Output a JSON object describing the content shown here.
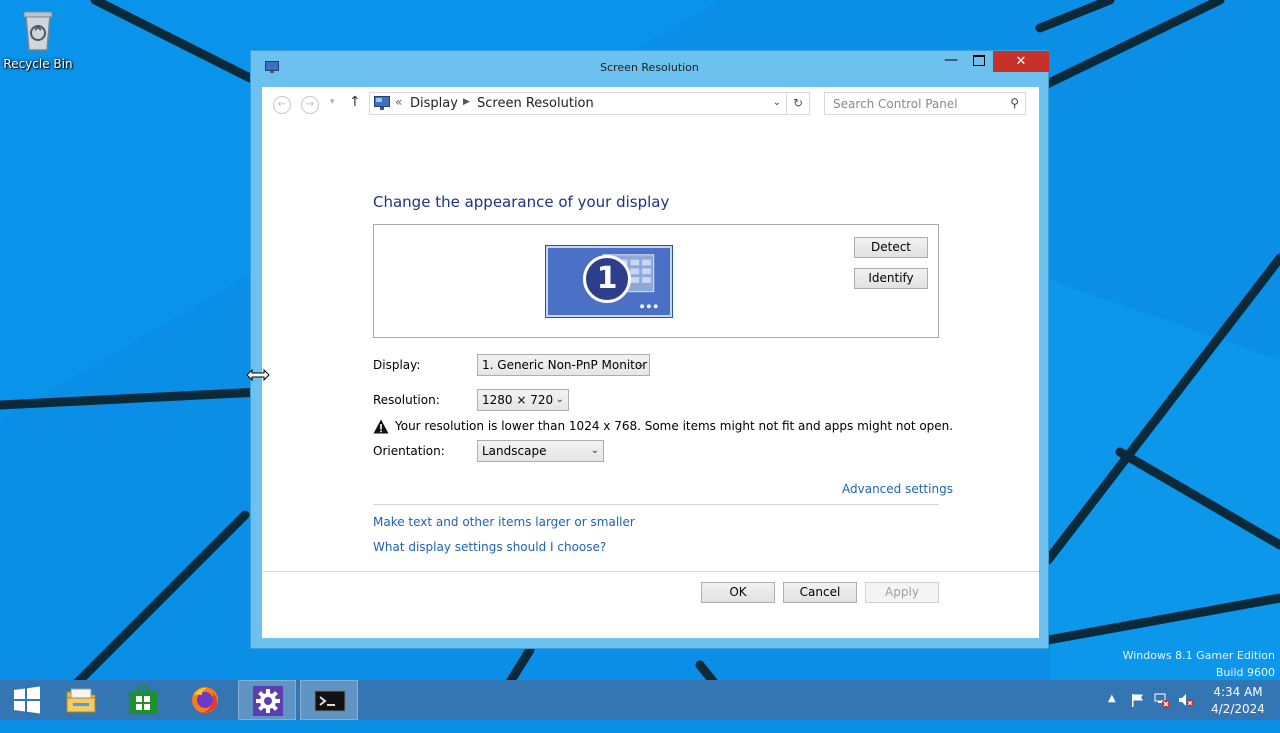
{
  "desktop": {
    "recycle_bin_label": "Recycle Bin",
    "watermark_line1": "Windows 8.1 Gamer Edition",
    "watermark_line2": "Build 9600"
  },
  "window": {
    "title": "Screen Resolution",
    "close_glyph": "✕",
    "minimize_glyph": "—"
  },
  "navbar": {
    "breadcrumb_separator": "«",
    "crumb_display": "Display",
    "crumb_current": "Screen Resolution",
    "search_placeholder": "Search Control Panel"
  },
  "main": {
    "heading": "Change the appearance of your display",
    "monitor_number": "1",
    "detect_label": "Detect",
    "identify_label": "Identify",
    "display_label": "Display:",
    "display_value": "1. Generic Non-PnP Monitor",
    "resolution_label": "Resolution:",
    "resolution_value": "1280 × 720",
    "warning_text": "Your resolution is lower than 1024 x 768. Some items might not fit and apps might not open.",
    "orientation_label": "Orientation:",
    "orientation_value": "Landscape",
    "advanced_link": "Advanced settings",
    "larger_link": "Make text and other items larger or smaller",
    "choose_link": "What display settings should I choose?",
    "ok_label": "OK",
    "cancel_label": "Cancel",
    "apply_label": "Apply"
  },
  "taskbar": {
    "items": [
      "start-button",
      "file-explorer",
      "store",
      "firefox",
      "settings",
      "terminal"
    ],
    "clock_time": "4:34 AM",
    "clock_date": "4/2/2024"
  },
  "colors": {
    "desktop_bg": "#0a8ee6",
    "window_frame": "#6cc1ef",
    "close_button": "#c7312a",
    "heading": "#1e3287",
    "link": "#1d64b4",
    "taskbar": "#3376b3"
  }
}
